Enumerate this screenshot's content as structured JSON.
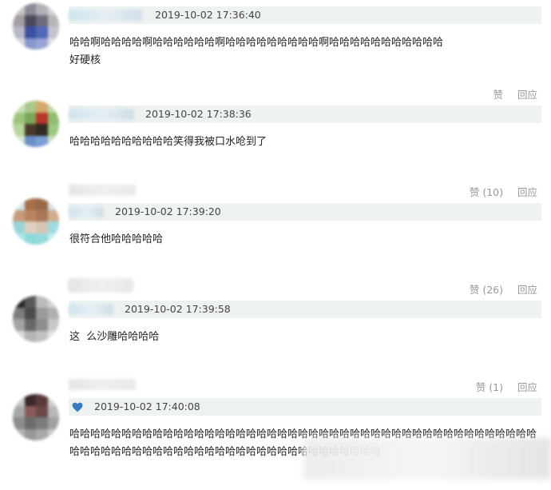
{
  "comments": [
    {
      "time": "2019-10-02 17:36:40",
      "text": "哈哈啊哈哈哈哈啊哈哈哈哈哈哈啊哈哈哈哈哈哈哈哈哈啊哈哈哈哈哈哈哈哈哈哈哈\n好硬核",
      "like_label": "赞",
      "reply_label": "回应"
    },
    {
      "time": "2019-10-02 17:38:36",
      "text": "哈哈哈哈哈哈哈哈哈哈笑得我被口水呛到了",
      "like_label": "赞 (10)",
      "reply_label": "回应"
    },
    {
      "time": "2019-10-02 17:39:20",
      "text": "很符合他哈哈哈哈哈",
      "like_label": "赞 (26)",
      "reply_label": "回应"
    },
    {
      "time": "2019-10-02 17:39:58",
      "text": "这  么沙雕哈哈哈哈",
      "like_label": "赞 (1)",
      "reply_label": "回应"
    },
    {
      "time": "2019-10-02 17:40:08",
      "text": "哈哈哈哈哈哈哈哈哈哈哈哈哈哈哈哈哈哈哈哈哈哈哈哈哈哈哈哈哈哈哈哈哈哈哈哈哈哈哈哈哈哈哈哈哈哈哈哈哈哈哈哈哈哈哈哈哈哈哈哈哈哈哈哈哈哈哈哈哈哈哈哈哈哈哈",
      "heart_icon": "heart-icon",
      "heart_color": "#3a7cc4"
    }
  ]
}
